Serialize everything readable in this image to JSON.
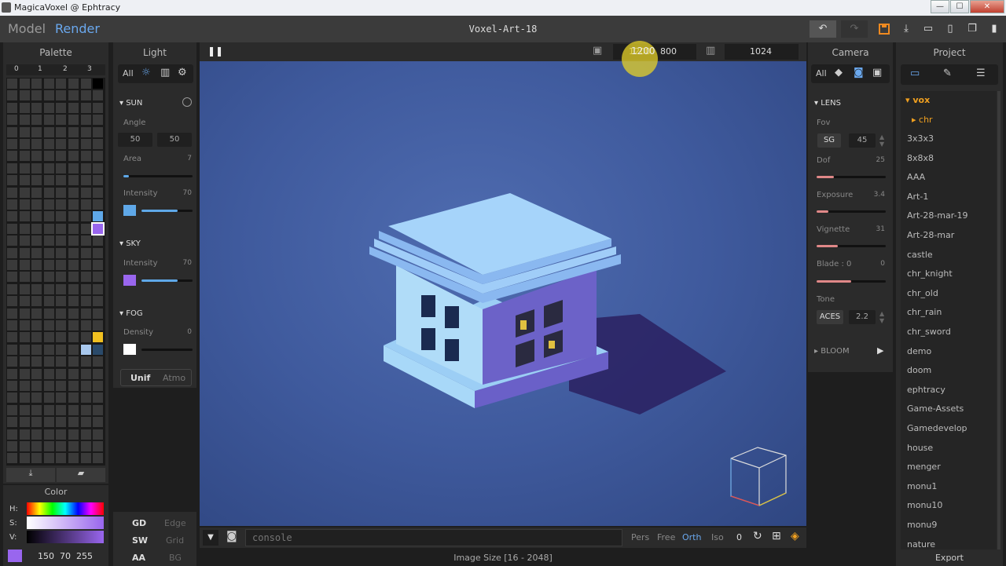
{
  "window": {
    "title": "MagicaVoxel @ Ephtracy",
    "min_glyph": "—",
    "max_glyph": "☐",
    "close_glyph": "✕"
  },
  "modes": {
    "model": "Model",
    "render": "Render"
  },
  "document_title": "Voxel-Art-18",
  "render_bar": {
    "width": "1200",
    "height": "800",
    "samples": "1024"
  },
  "palette": {
    "title": "Palette",
    "columns": [
      "0",
      "1",
      "2",
      "3"
    ],
    "highlight_colors": {
      "black": "#000000",
      "blue": "#5fa8e8",
      "purple": "#9966ee",
      "yellow": "#f0c020",
      "light_blue": "#a8c8ee",
      "dark_blue": "#2a4a6a"
    }
  },
  "color_panel": {
    "title": "Color",
    "h_label": "H:",
    "s_label": "S:",
    "v_label": "V:",
    "values": "150  70  255",
    "current_color": "#9966ee"
  },
  "light": {
    "title": "Light",
    "all_label": "All",
    "sun": {
      "label": "SUN",
      "angle_label": "Angle",
      "angle_a": "50",
      "angle_b": "50",
      "area_label": "Area",
      "area_value": "7",
      "intensity_label": "Intensity",
      "intensity_value": "70",
      "color": "#5fa8e8"
    },
    "sky": {
      "label": "SKY",
      "intensity_label": "Intensity",
      "intensity_value": "70",
      "color": "#9966ee"
    },
    "fog": {
      "label": "FOG",
      "density_label": "Density",
      "density_value": "0",
      "color": "#ffffff"
    },
    "unif_label": "Unif",
    "atmo_label": "Atmo",
    "bottom": {
      "gd": "GD",
      "edge": "Edge",
      "sw": "SW",
      "grid": "Grid",
      "aa": "AA",
      "bg": "BG"
    }
  },
  "camera": {
    "title": "Camera",
    "all_label": "All",
    "lens_label": "LENS",
    "fov_label": "Fov",
    "fov_mode": "SG",
    "fov_value": "45",
    "dof_label": "Dof",
    "dof_value": "25",
    "exposure_label": "Exposure",
    "exposure_value": "3.4",
    "vignette_label": "Vignette",
    "vignette_value": "31",
    "blade_label": "Blade : 0",
    "blade_value": "0",
    "tone_label": "Tone",
    "tone_mode": "ACES",
    "tone_value": "2.2",
    "bloom_label": "BLOOM"
  },
  "project": {
    "title": "Project",
    "folders": [
      {
        "label": "vox"
      },
      {
        "label": "chr"
      }
    ],
    "items": [
      "3x3x3",
      "8x8x8",
      "AAA",
      "Art-1",
      "Art-28-mar-19",
      "Art-28-mar",
      "castle",
      "chr_knight",
      "chr_old",
      "chr_rain",
      "chr_sword",
      "demo",
      "doom",
      "ephtracy",
      "Game-Assets",
      "Gamedevelop",
      "house",
      "menger",
      "monu1",
      "monu10",
      "monu9",
      "nature"
    ],
    "export_label": "Export"
  },
  "console": {
    "placeholder": "console",
    "view_modes": [
      "Pers",
      "Free",
      "Orth",
      "Iso"
    ],
    "active_view": "Orth",
    "number": "0"
  },
  "status": {
    "image_size": "Image Size [16 - 2048]"
  }
}
